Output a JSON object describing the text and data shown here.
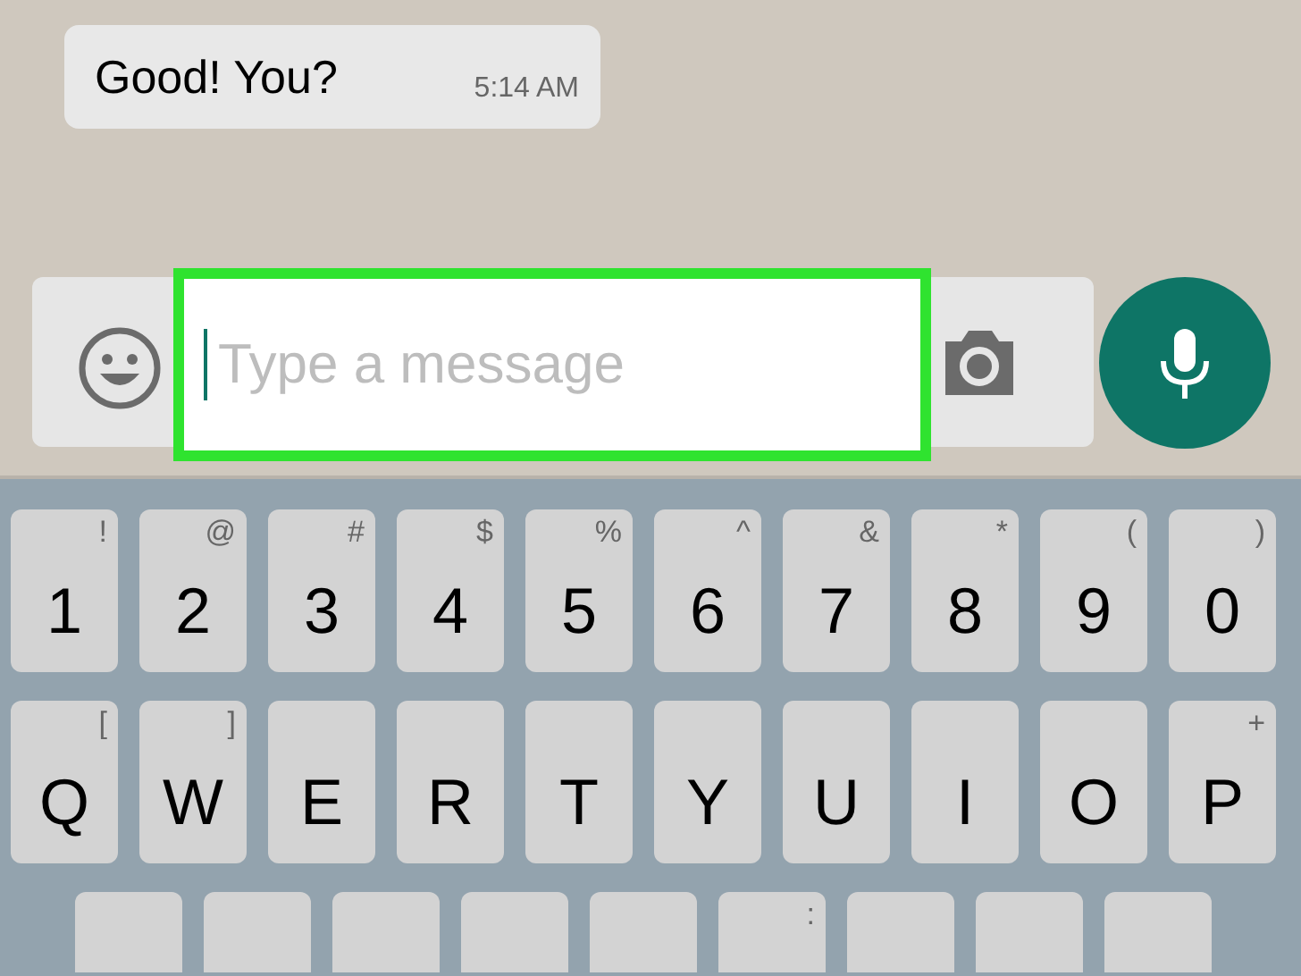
{
  "chat": {
    "messages": [
      {
        "text": "Good! You?",
        "time": "5:14 AM"
      }
    ]
  },
  "composer": {
    "placeholder": "Type a message",
    "highlighted": true
  },
  "keyboard": {
    "rows": [
      {
        "keys": [
          {
            "kind": "full",
            "label": "1",
            "hint": "!"
          },
          {
            "kind": "full",
            "label": "2",
            "hint": "@"
          },
          {
            "kind": "full",
            "label": "3",
            "hint": "#"
          },
          {
            "kind": "full",
            "label": "4",
            "hint": "$"
          },
          {
            "kind": "full",
            "label": "5",
            "hint": "%"
          },
          {
            "kind": "full",
            "label": "6",
            "hint": "^"
          },
          {
            "kind": "full",
            "label": "7",
            "hint": "&"
          },
          {
            "kind": "full",
            "label": "8",
            "hint": "*"
          },
          {
            "kind": "full",
            "label": "9",
            "hint": "("
          },
          {
            "kind": "full",
            "label": "0",
            "hint": ")"
          }
        ]
      },
      {
        "keys": [
          {
            "kind": "full",
            "label": "Q",
            "hint": "["
          },
          {
            "kind": "full",
            "label": "W",
            "hint": "]"
          },
          {
            "kind": "full",
            "label": "E"
          },
          {
            "kind": "full",
            "label": "R"
          },
          {
            "kind": "full",
            "label": "T"
          },
          {
            "kind": "full",
            "label": "Y"
          },
          {
            "kind": "full",
            "label": "U"
          },
          {
            "kind": "full",
            "label": "I"
          },
          {
            "kind": "full",
            "label": "O"
          },
          {
            "kind": "full",
            "label": "P",
            "hint": "+"
          }
        ]
      },
      {
        "keys": [
          {
            "kind": "cut"
          },
          {
            "kind": "cut"
          },
          {
            "kind": "cut"
          },
          {
            "kind": "cut"
          },
          {
            "kind": "cut"
          },
          {
            "kind": "cut",
            "hint": ":"
          },
          {
            "kind": "cut"
          },
          {
            "kind": "cut"
          },
          {
            "kind": "cut"
          }
        ]
      }
    ]
  }
}
